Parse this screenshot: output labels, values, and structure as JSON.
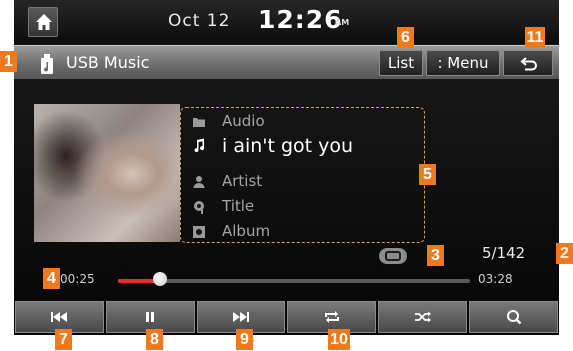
{
  "status_bar": {
    "date": "Oct 12",
    "time": "12:26",
    "ampm": "AM"
  },
  "header": {
    "title": "USB Music",
    "list_label": "List",
    "menu_label": ": Menu"
  },
  "now_playing": {
    "folder": "Audio",
    "song": "i ain't got you",
    "artist": "Artist",
    "title": "Title",
    "album": "Album",
    "track_count": "5/142",
    "current_time": "00:25",
    "total_time": "03:28",
    "progress_fraction": 0.12
  },
  "controls": [
    "previous-icon",
    "pause-icon",
    "next-icon",
    "repeat-icon",
    "shuffle-icon",
    "search-icon"
  ],
  "callouts": [
    "1",
    "2",
    "3",
    "4",
    "5",
    "6",
    "7",
    "8",
    "9",
    "10",
    "11"
  ],
  "colors": {
    "accent": "#e0302e",
    "callout": "#f0781e",
    "info_border": "#d9a45a"
  }
}
